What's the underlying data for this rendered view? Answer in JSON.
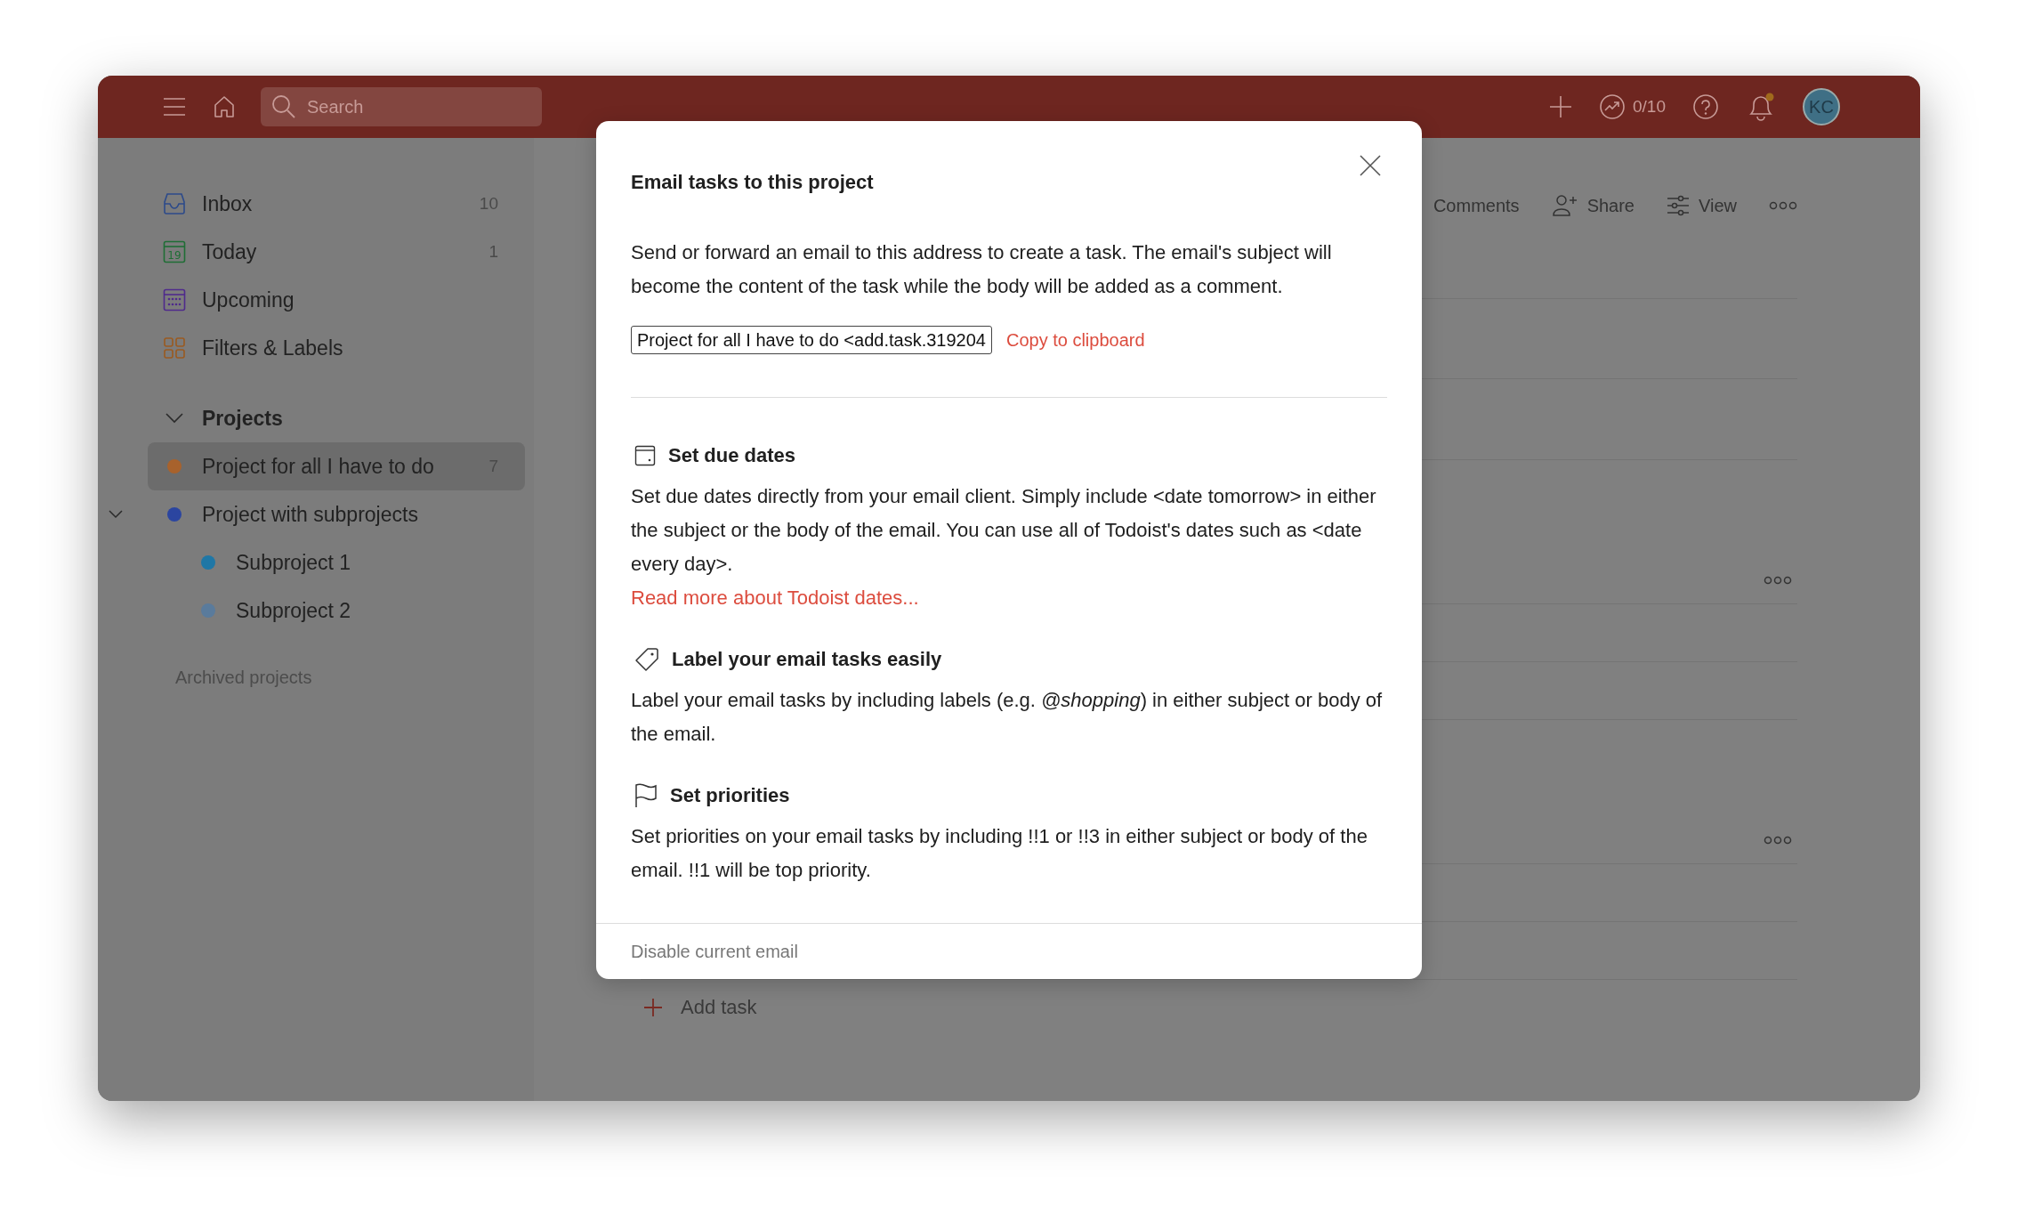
{
  "topbar": {
    "search": {
      "placeholder": "Search"
    },
    "karma": "0/10",
    "avatar": "KC"
  },
  "sidebar": {
    "nav": [
      {
        "kind": "inbox",
        "label": "Inbox",
        "count": "10"
      },
      {
        "kind": "today",
        "label": "Today",
        "count": "1",
        "icon_text": "19"
      },
      {
        "kind": "upcoming",
        "label": "Upcoming"
      },
      {
        "kind": "filters",
        "label": "Filters & Labels"
      }
    ],
    "projects": {
      "title": "Projects",
      "expanded": true,
      "items": [
        {
          "name": "Project for all I have to do",
          "count": "7",
          "color": "#a8622c",
          "selected": true
        },
        {
          "name": "Project with subprojects",
          "color": "#2b45a0",
          "selected": false,
          "expanded": true,
          "children": [
            {
              "name": "Subproject 1",
              "color": "#1f77a6",
              "selected": false
            },
            {
              "name": "Subproject 2",
              "color": "#5a7b9c",
              "selected": false
            }
          ]
        }
      ]
    },
    "archived": "Archived projects"
  },
  "main": {
    "actions": [
      {
        "kind": "comments",
        "label": "Comments"
      },
      {
        "kind": "share",
        "label": "Share"
      },
      {
        "kind": "view",
        "label": "View"
      }
    ],
    "add_task": "Add task"
  },
  "dialog": {
    "title": "Email tasks to this project",
    "intro": "Send or forward an email to this address to create a task. The email's subject will become the content of the task while the body will be added as a comment.",
    "email": {
      "value": "Project for all I have to do <add.task.319204"
    },
    "copy": "Copy to clipboard",
    "sections": [
      {
        "kind": "dates",
        "heading": "Set due dates",
        "text": "Set due dates directly from your email client. Simply include <date tomorrow> in either the subject or the body of the email. You can use all of Todoist's dates such as <date every day>.",
        "link": "Read more about Todoist dates..."
      },
      {
        "kind": "labels",
        "heading": "Label your email tasks easily",
        "text": "Label your email tasks by including labels (e.g. *@shopping*) in either subject or body of the email."
      },
      {
        "kind": "priorities",
        "heading": "Set priorities",
        "text": "Set priorities on your email tasks by including !!1 or !!3 in either subject or body of the email. !!1 will be top priority."
      }
    ],
    "footer": "Disable current email"
  }
}
